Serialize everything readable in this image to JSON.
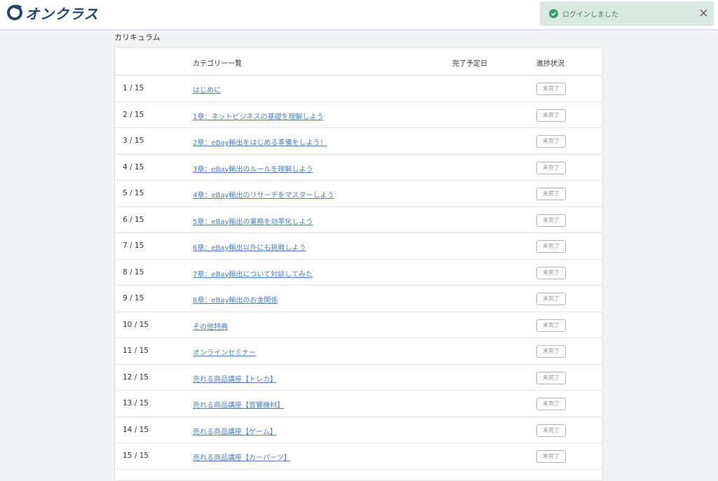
{
  "header": {
    "logo_text": "オンクラス"
  },
  "toast": {
    "message": "ログインしました"
  },
  "page": {
    "section_title": "カリキュラム"
  },
  "table": {
    "headers": {
      "category": "カテゴリー一覧",
      "due_date": "完了予定日",
      "progress": "進捗状況"
    },
    "rows": [
      {
        "num": "1 / 15",
        "title": "はじめに",
        "status": "未完了"
      },
      {
        "num": "2 / 15",
        "title": "1章：ネットビジネスの基礎を理解しよう",
        "status": "未完了"
      },
      {
        "num": "3 / 15",
        "title": "2章：eBay輸出をはじめる準備をしよう！",
        "status": "未完了"
      },
      {
        "num": "4 / 15",
        "title": "3章：eBay輸出のルールを理解しよう",
        "status": "未完了"
      },
      {
        "num": "5 / 15",
        "title": "4章：eBay輸出のリサーチをマスターしよう",
        "status": "未完了"
      },
      {
        "num": "6 / 15",
        "title": "5章：eBay輸出の業務を効率化しよう",
        "status": "未完了"
      },
      {
        "num": "7 / 15",
        "title": "6章：eBay輸出以外にも挑戦しよう",
        "status": "未完了"
      },
      {
        "num": "8 / 15",
        "title": "7章：eBay輸出について対談してみた",
        "status": "未完了"
      },
      {
        "num": "9 / 15",
        "title": "8章：eBay輸出のお金関係",
        "status": "未完了"
      },
      {
        "num": "10 / 15",
        "title": "その他特典",
        "status": "未完了"
      },
      {
        "num": "11 / 15",
        "title": "オンラインセミナー",
        "status": "未完了"
      },
      {
        "num": "12 / 15",
        "title": "売れる商品講座【トレカ】",
        "status": "未完了"
      },
      {
        "num": "13 / 15",
        "title": "売れる商品講座【音響機材】",
        "status": "未完了"
      },
      {
        "num": "14 / 15",
        "title": "売れる商品講座【ゲーム】",
        "status": "未完了"
      },
      {
        "num": "15 / 15",
        "title": "売れる商品講座【カーパーツ】",
        "status": "未完了"
      }
    ]
  },
  "colors": {
    "brand": "#23456e",
    "link": "#4a7fc0",
    "toast_bg": "#dbe9e3",
    "toast_text": "#3d7a5e"
  },
  "icons": {
    "logo": "logo-mark-icon",
    "toast_check": "check-circle-icon",
    "toast_close": "close-icon"
  }
}
